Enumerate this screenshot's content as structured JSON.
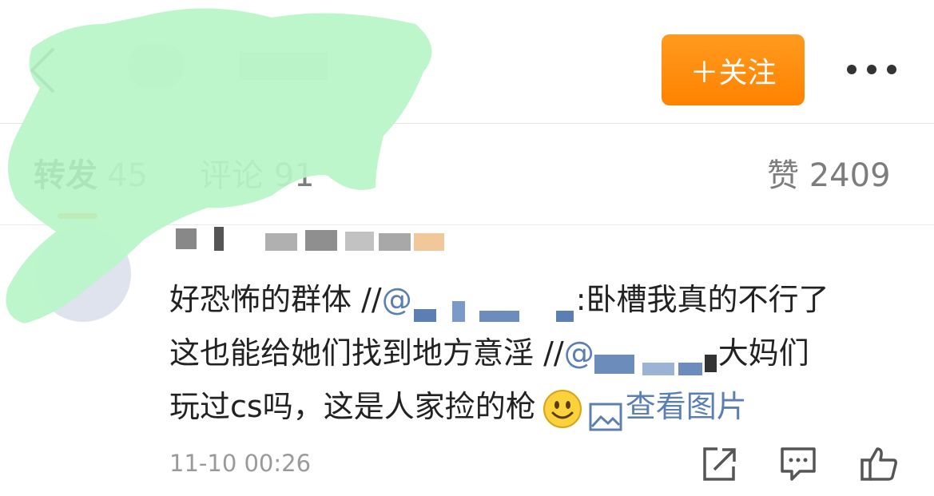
{
  "header": {
    "follow_label": "＋关注"
  },
  "tabs": {
    "repost_label": "转发",
    "repost_count": "45",
    "comment_label": "评论",
    "comment_count": "91",
    "like_label": "赞",
    "like_count": "2409"
  },
  "comment": {
    "line1_text": "好恐怖的群体 //",
    "line1_mention_prefix": "@",
    "line1_after": ":卧槽我真的不行了",
    "line2_text": "这也能给她们找到地方意淫 //",
    "line2_mention_prefix": "@",
    "line2_after": "大妈们",
    "line3_text": "玩过cs吗，这是人家捡的枪",
    "view_image_label": "查看图片",
    "timestamp": "11-10 00:26"
  },
  "colors": {
    "accent": "#ff8200",
    "link": "#5b7fb3",
    "censor": "#b8f5c8"
  },
  "icons": {
    "back": "chevron-left-icon",
    "more": "more-dots-icon",
    "smiley": "smiley-emoji-icon",
    "image": "image-icon",
    "share": "share-icon",
    "comment": "comment-icon",
    "like": "thumbs-up-icon"
  }
}
